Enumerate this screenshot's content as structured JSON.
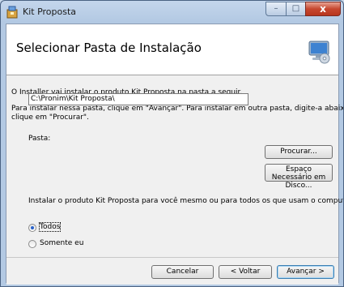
{
  "window": {
    "title": "Kit Proposta",
    "min_label": "–",
    "max_label": "□",
    "close_label": "x"
  },
  "header": {
    "title": "Selecionar Pasta de Instalação",
    "icon": "installer-computer-disc-icon"
  },
  "body": {
    "intro": "O Installer vai instalar o produto Kit Proposta na pasta a seguir.",
    "instructions_line1": "Para instalar nessa pasta, clique em \"Avançar\". Para instalar em outra pasta, digite-a abaixo ou",
    "instructions_line2": "clique em \"Procurar\".",
    "folder_label": "Pasta:",
    "folder_value": "C:\\Pronim\\Kit Proposta\\",
    "browse_button": "Procurar...",
    "disk_space_line1": "Espaço Necessário em",
    "disk_space_line2": "Disco...",
    "install_for_label": "Instalar o produto Kit Proposta para você mesmo ou para todos os que usam o computador:",
    "radio_everyone": "Todos",
    "radio_just_me": "Somente eu",
    "selected": "Todos"
  },
  "footer": {
    "cancel_button": "Cancelar",
    "back_button": "< Voltar",
    "next_button": "Avançar >"
  }
}
